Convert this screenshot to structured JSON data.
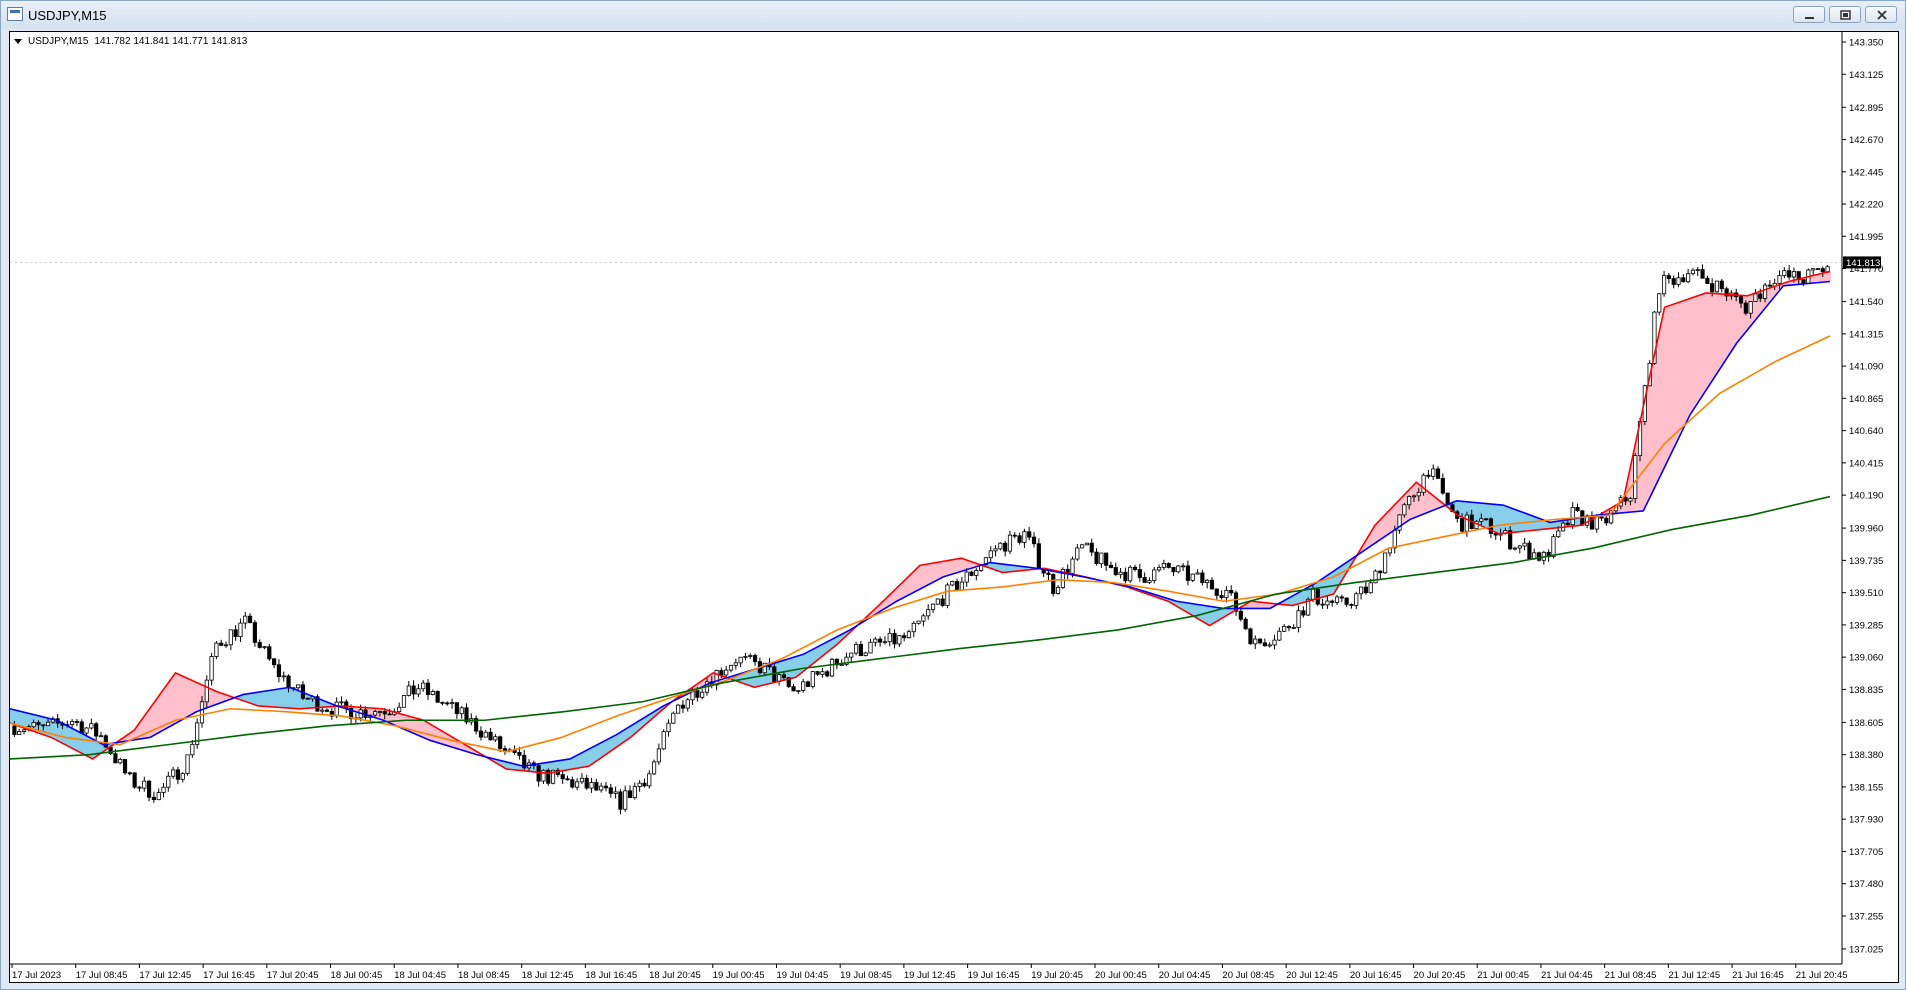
{
  "window": {
    "title": "USDJPY,M15",
    "buttons": [
      "minimize",
      "restore",
      "close"
    ]
  },
  "infobar": {
    "symbol": "USDJPY,M15",
    "ohlc": "141.782 141.841 141.771 141.813"
  },
  "chart_data": {
    "type": "candlestick",
    "title": "USDJPY,M15",
    "ylim": [
      136.92,
      143.42
    ],
    "y_ticks": [
      "143.350",
      "143.125",
      "142.895",
      "142.670",
      "142.445",
      "142.220",
      "141.995",
      "141.770",
      "141.540",
      "141.315",
      "141.090",
      "140.865",
      "140.640",
      "140.415",
      "140.190",
      "139.960",
      "139.735",
      "139.510",
      "139.285",
      "139.060",
      "138.835",
      "138.605",
      "138.380",
      "138.155",
      "137.930",
      "137.705",
      "137.480",
      "137.255",
      "137.025"
    ],
    "x_ticks": [
      "17 Jul 2023",
      "17 Jul 08:45",
      "17 Jul 12:45",
      "17 Jul 16:45",
      "17 Jul 20:45",
      "18 Jul 00:45",
      "18 Jul 04:45",
      "18 Jul 08:45",
      "18 Jul 12:45",
      "18 Jul 16:45",
      "18 Jul 20:45",
      "19 Jul 00:45",
      "19 Jul 04:45",
      "19 Jul 08:45",
      "19 Jul 12:45",
      "19 Jul 16:45",
      "19 Jul 20:45",
      "20 Jul 00:45",
      "20 Jul 04:45",
      "20 Jul 08:45",
      "20 Jul 12:45",
      "20 Jul 16:45",
      "20 Jul 20:45",
      "21 Jul 00:45",
      "21 Jul 04:45",
      "21 Jul 08:45",
      "21 Jul 12:45",
      "21 Jul 16:45",
      "21 Jul 20:45"
    ],
    "current_price": "141.813",
    "close_anchors": [
      138.58,
      138.56,
      138.62,
      138.51,
      138.2,
      138.1,
      138.35,
      139.15,
      139.3,
      138.98,
      138.78,
      138.7,
      138.68,
      138.7,
      138.85,
      138.72,
      138.58,
      138.4,
      138.25,
      138.2,
      138.15,
      138.05,
      138.25,
      138.72,
      138.9,
      139.05,
      138.98,
      138.82,
      138.95,
      139.1,
      139.15,
      139.2,
      139.45,
      139.62,
      139.82,
      139.92,
      139.55,
      139.82,
      139.68,
      139.62,
      139.68,
      139.6,
      139.52,
      139.15,
      139.25,
      139.48,
      139.42,
      139.55,
      140.02,
      140.38,
      140.0,
      139.98,
      139.85,
      139.75,
      140.05,
      139.98,
      140.2,
      141.65,
      141.75,
      141.65,
      141.5,
      141.72,
      141.7,
      141.8
    ],
    "candles_per_segment": 6,
    "series": [
      {
        "name": "MA-fast",
        "color": "#ff0000",
        "values": [
          138.6,
          138.5,
          138.35,
          138.55,
          138.95,
          138.82,
          138.72,
          138.7,
          138.72,
          138.7,
          138.62,
          138.45,
          138.28,
          138.25,
          138.3,
          138.5,
          138.75,
          138.95,
          138.85,
          138.92,
          139.15,
          139.42,
          139.7,
          139.75,
          139.65,
          139.68,
          139.62,
          139.55,
          139.45,
          139.28,
          139.45,
          139.42,
          139.5,
          139.98,
          140.28,
          140.05,
          139.92,
          139.95,
          139.98,
          140.15,
          141.5,
          141.6,
          141.58,
          141.68,
          141.75
        ]
      },
      {
        "name": "MA-mid",
        "color": "#0000ff",
        "values": [
          138.7,
          138.62,
          138.45,
          138.5,
          138.68,
          138.8,
          138.85,
          138.72,
          138.62,
          138.48,
          138.38,
          138.3,
          138.35,
          138.52,
          138.72,
          138.88,
          138.98,
          139.08,
          139.25,
          139.45,
          139.62,
          139.72,
          139.68,
          139.62,
          139.55,
          139.45,
          139.4,
          139.4,
          139.58,
          139.8,
          140.02,
          140.15,
          140.12,
          140.0,
          140.05,
          140.08,
          140.75,
          141.25,
          141.65,
          141.68
        ]
      },
      {
        "name": "MA-slow",
        "color": "#ff8000",
        "values": [
          138.6,
          138.5,
          138.45,
          138.62,
          138.7,
          138.68,
          138.65,
          138.58,
          138.48,
          138.4,
          138.5,
          138.65,
          138.78,
          138.9,
          139.05,
          139.25,
          139.4,
          139.52,
          139.55,
          139.6,
          139.58,
          139.52,
          139.45,
          139.5,
          139.62,
          139.82,
          139.9,
          139.98,
          140.02,
          140.05,
          140.55,
          140.9,
          141.12,
          141.3
        ]
      },
      {
        "name": "MA-long",
        "color": "#006400",
        "values": [
          138.35,
          138.38,
          138.45,
          138.52,
          138.58,
          138.62,
          138.62,
          138.68,
          138.75,
          138.88,
          138.98,
          139.05,
          139.12,
          139.18,
          139.25,
          139.35,
          139.5,
          139.58,
          139.65,
          139.72,
          139.82,
          139.95,
          140.05,
          140.18
        ]
      }
    ],
    "fill_colors": {
      "bull": "#ffc0cb",
      "bear": "#87ceeb"
    },
    "grid": false,
    "legend": "none"
  }
}
